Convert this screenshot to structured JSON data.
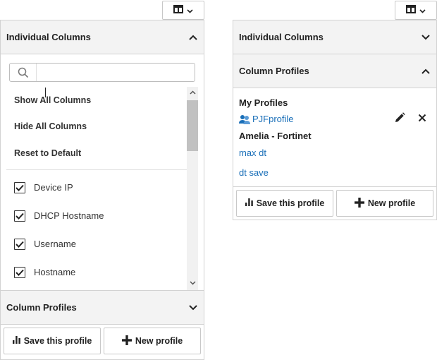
{
  "left_panel": {
    "individual_columns": {
      "title": "Individual Columns",
      "expanded": true
    },
    "search": {
      "placeholder": "",
      "value": ""
    },
    "actions": [
      {
        "label": "Show All Columns"
      },
      {
        "label": "Hide All Columns"
      },
      {
        "label": "Reset to Default"
      }
    ],
    "columns": [
      {
        "label": "Device IP",
        "checked": true
      },
      {
        "label": "DHCP Hostname",
        "checked": true
      },
      {
        "label": "Username",
        "checked": true
      },
      {
        "label": "Hostname",
        "checked": true
      }
    ],
    "column_profiles": {
      "title": "Column Profiles",
      "expanded": false
    },
    "footer": {
      "save_label": "Save this profile",
      "new_label": "New profile"
    }
  },
  "right_panel": {
    "individual_columns": {
      "title": "Individual Columns",
      "expanded": false
    },
    "column_profiles": {
      "title": "Column Profiles",
      "expanded": true
    },
    "my_profiles_heading": "My Profiles",
    "my_profiles": [
      {
        "label": "PJFprofile",
        "shared": true
      }
    ],
    "group_heading": "Amelia - Fortinet",
    "group_profiles": [
      {
        "label": "max dt"
      },
      {
        "label": "dt save"
      }
    ],
    "footer": {
      "save_label": "Save this profile",
      "new_label": "New profile"
    }
  },
  "colors": {
    "link": "#1a6fb8",
    "header_bg": "#f3f3f3",
    "border": "#d2d2d2"
  }
}
